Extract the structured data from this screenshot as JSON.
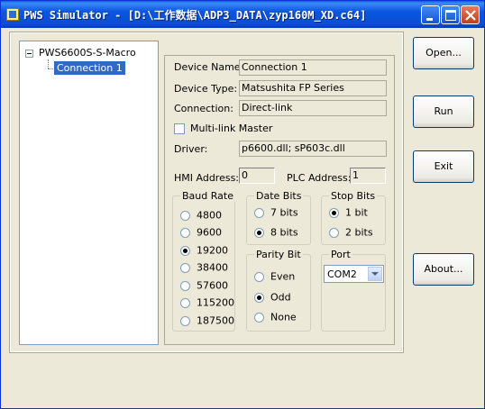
{
  "window": {
    "title": "PWS Simulator - [D:\\工作数据\\ADP3_DATA\\zyp160M_XD.c64]",
    "accent_color": "#0a4fd4",
    "controls": [
      "minimize-icon",
      "maximize-icon",
      "close-icon"
    ]
  },
  "tree": {
    "expander_symbol": "−",
    "root_label": "PWS6600S-S-Macro",
    "child_label": "Connection 1"
  },
  "props": {
    "device_name_label": "Device Name:",
    "device_name_value": "Connection 1",
    "device_type_label": "Device Type:",
    "device_type_value": "Matsushita FP Series",
    "connection_label": "Connection:",
    "connection_value": "Direct-link",
    "multilink_label": "Multi-link Master",
    "multilink_checked": false,
    "driver_label": "Driver:",
    "driver_value": "p6600.dll; sP603c.dll",
    "hmi_address_label": "HMI Address:",
    "hmi_address_value": "0",
    "plc_address_label": "PLC Address:",
    "plc_address_value": "1"
  },
  "baud_rate": {
    "title": "Baud Rate",
    "options": [
      "4800",
      "9600",
      "19200",
      "38400",
      "57600",
      "115200",
      "187500"
    ],
    "selected": "19200"
  },
  "date_bits": {
    "title": "Date Bits",
    "options": [
      "7 bits",
      "8 bits"
    ],
    "selected": "8 bits"
  },
  "stop_bits": {
    "title": "Stop Bits",
    "options": [
      "1 bit",
      "2 bits"
    ],
    "selected": "1 bit"
  },
  "parity_bit": {
    "title": "Parity Bit",
    "options": [
      "Even",
      "Odd",
      "None"
    ],
    "selected": "Odd"
  },
  "port": {
    "title": "Port",
    "selected": "COM2"
  },
  "buttons": {
    "open": "Open...",
    "run": "Run",
    "exit": "Exit",
    "about": "About..."
  }
}
